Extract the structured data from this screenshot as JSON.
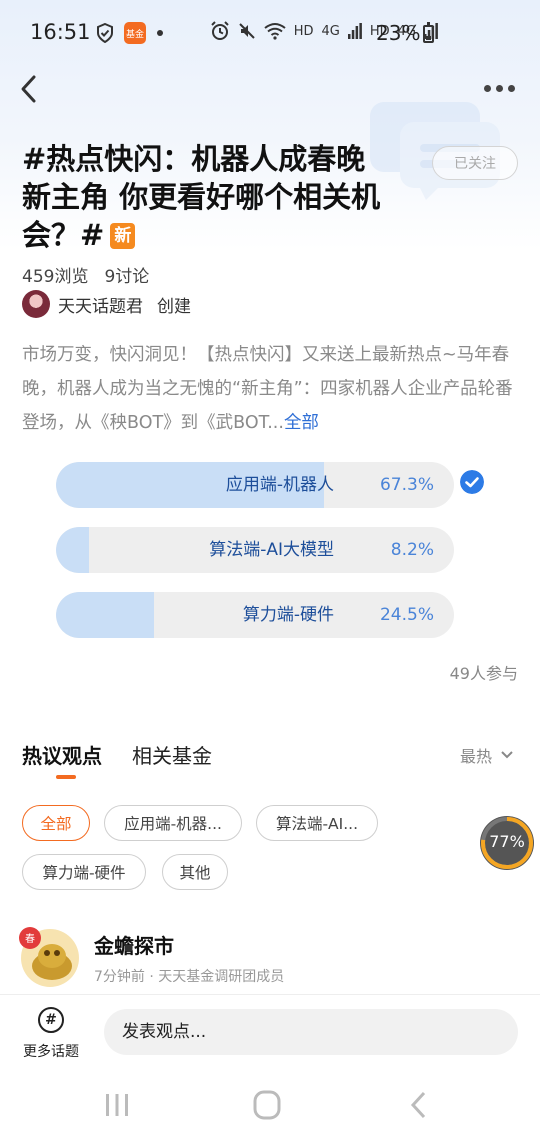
{
  "status_bar": {
    "time": "16:51",
    "app_badge": "基金",
    "network_hd_1": "HD",
    "network_4g_1": "4G",
    "network_hd_2": "HD",
    "network_4g_2": "4G",
    "battery": "23%"
  },
  "topic": {
    "title": "#热点快闪：机器人成春晚新主角 你更看好哪个相关机会？#",
    "new_tag": "新",
    "follow_label": "已关注",
    "views": "459浏览",
    "discussions": "9讨论",
    "creator_name": "天天话题君",
    "creator_action": "创建",
    "description": "市场万变，快闪洞见！【热点快闪】又来送上最新热点~马年春晚，机器人成为当之无愧的“新主角”：四家机器人企业产品轮番登场，从《秧BOT》到《武BOT...",
    "more_label": "全部"
  },
  "poll": {
    "options": [
      {
        "label": "应用端-机器人",
        "percent_text": "67.3%",
        "share": 0.673,
        "selected": true
      },
      {
        "label": "算法端-AI大模型",
        "percent_text": "8.2%",
        "share": 0.082,
        "selected": false
      },
      {
        "label": "算力端-硬件",
        "percent_text": "24.5%",
        "share": 0.245,
        "selected": false
      }
    ],
    "participants": "49人参与"
  },
  "tabs": {
    "hot_opinions": "热议观点",
    "related_funds": "相关基金",
    "sort_label": "最热"
  },
  "filters": [
    "全部",
    "应用端-机器...",
    "算法端-AI...",
    "算力端-硬件",
    "其他"
  ],
  "progress_bubble": "77%",
  "post": {
    "author": "金蟾探市",
    "meta": "7分钟前 · 天天基金调研团成员",
    "avatar_badge": "春"
  },
  "bottom_bar": {
    "topic_icon": "#",
    "topic_label": "更多话题",
    "input_placeholder": "发表观点..."
  },
  "colors": {
    "accent": "#f36b21",
    "poll_fill": "#c9def6",
    "poll_text": "#1d4e9a",
    "link": "#2f6fd6"
  }
}
